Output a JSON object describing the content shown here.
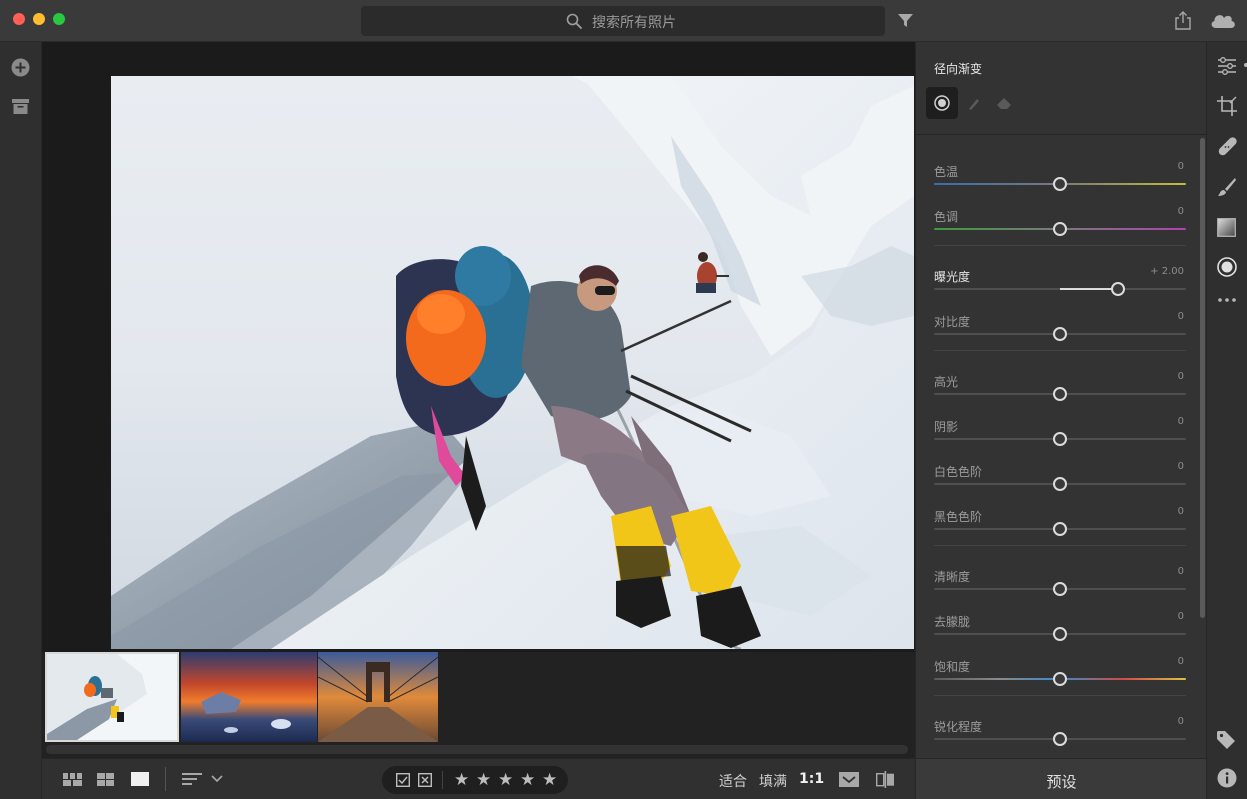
{
  "search": {
    "placeholder": "搜索所有照片"
  },
  "edit_panel": {
    "title": "径向渐变",
    "sliders": [
      {
        "label": "色温",
        "value": "0",
        "active": false
      },
      {
        "label": "色调",
        "value": "0",
        "active": false
      },
      {
        "label": "曝光度",
        "value": "+ 2.00",
        "active": true
      },
      {
        "label": "对比度",
        "value": "0",
        "active": false
      },
      {
        "label": "高光",
        "value": "0",
        "active": false
      },
      {
        "label": "阴影",
        "value": "0",
        "active": false
      },
      {
        "label": "白色色阶",
        "value": "0",
        "active": false
      },
      {
        "label": "黑色色阶",
        "value": "0",
        "active": false
      },
      {
        "label": "清晰度",
        "value": "0",
        "active": false
      },
      {
        "label": "去朦胧",
        "value": "0",
        "active": false
      },
      {
        "label": "饱和度",
        "value": "0",
        "active": false
      },
      {
        "label": "锐化程度",
        "value": "0",
        "active": false
      }
    ],
    "exposure_level": 0.73,
    "presets_label": "预设"
  },
  "bottom_bar": {
    "fit_label": "适合",
    "fill_label": "填满",
    "zoom_label": "1:1",
    "stars": [
      "★",
      "★",
      "★",
      "★",
      "★"
    ]
  },
  "icons": {
    "left": [
      "add-icon",
      "archive-icon"
    ],
    "right": [
      "edit-sliders-icon",
      "crop-icon",
      "healing-icon",
      "brush-icon",
      "linear-gradient-icon",
      "radial-gradient-icon",
      "more-icon",
      "tag-icon",
      "info-icon"
    ],
    "top": [
      "search-icon",
      "filter-icon",
      "share-icon",
      "cloud-icon"
    ]
  },
  "colors": {
    "app_bg": "#1e1e1e",
    "panel_bg": "#333333",
    "accent_traffic_red": "#fe5f57",
    "accent_traffic_yellow": "#febc2e",
    "accent_traffic_green": "#28c840"
  }
}
